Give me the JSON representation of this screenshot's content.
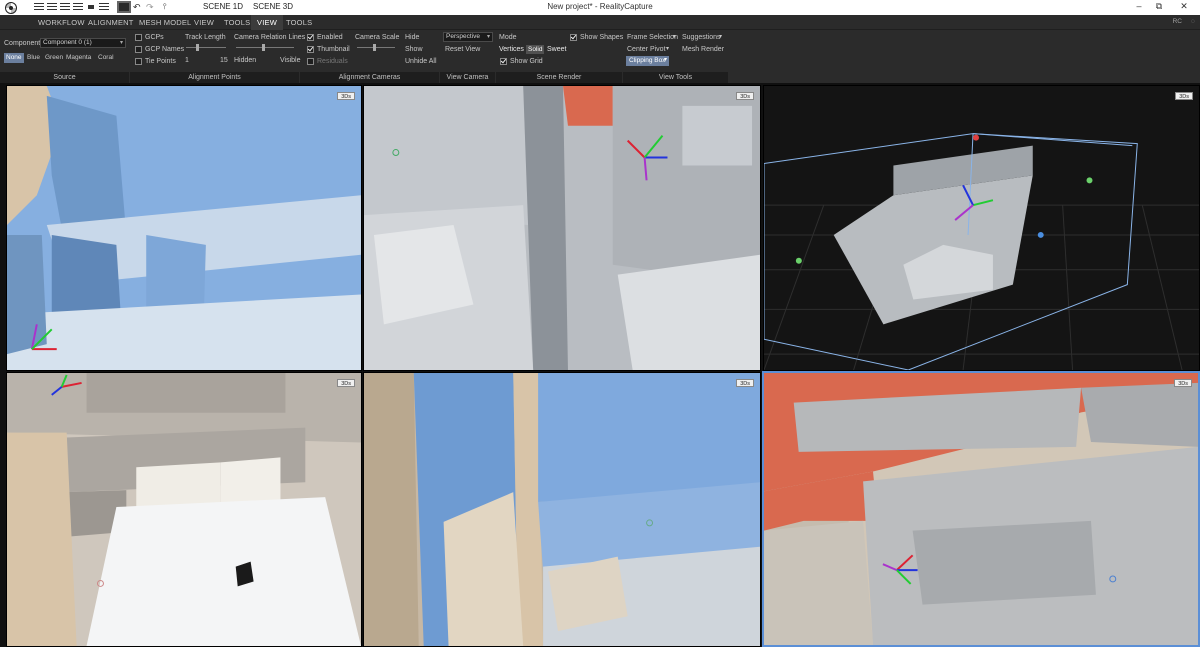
{
  "titlebar": {
    "scene_tabs": [
      "SCENE 1D",
      "SCENE 3D"
    ],
    "window_title": "New project* - RealityCapture",
    "controls": {
      "minimize": "–",
      "maximize": "⧉",
      "close": "✕"
    }
  },
  "menu": {
    "items": [
      "WORKFLOW",
      "ALIGNMENT",
      "MESH MODEL",
      "VIEW",
      "TOOLS",
      "VIEW",
      "TOOLS"
    ],
    "active_index": 5,
    "account_initials": "RC"
  },
  "ribbon": {
    "source": {
      "component_label": "Component",
      "component_value": "Component 0 (1)",
      "colors": [
        "None",
        "Blue",
        "Green",
        "Magenta",
        "Coral"
      ],
      "selected_color_index": 0,
      "section": "Source"
    },
    "alignment_points": {
      "gcps": "GCPs",
      "gcp_names": "GCP Names",
      "tie_points": "Tie Points",
      "track_length": "Track Length",
      "track_min": "1",
      "track_max": "15",
      "camera_relation_lines": "Camera Relation Lines",
      "hidden": "Hidden",
      "visible": "Visible",
      "section": "Alignment Points"
    },
    "alignment_cameras": {
      "enabled": "Enabled",
      "thumbnail": "Thumbnail",
      "residuals": "Residuals",
      "camera_scale": "Camera Scale",
      "hide": "Hide",
      "show": "Show",
      "unhide_all": "Unhide All",
      "section": "Alignment Cameras"
    },
    "view_camera": {
      "projection": "Perspective",
      "reset_view": "Reset View",
      "section": "View Camera"
    },
    "scene_render": {
      "mode": "Mode",
      "modes": [
        "Vertices",
        "Solid",
        "Sweet"
      ],
      "selected_mode_index": 1,
      "show_shapes": "Show Shapes",
      "show_grid": "Show Grid",
      "section": "Scene Render"
    },
    "view_tools": {
      "frame_selection": "Frame Selection",
      "suggestions": "Suggestions",
      "center_pivot": "Center Pivot",
      "mesh_render": "Mesh Render",
      "clipping_box": "Clipping Box",
      "section": "View Tools"
    }
  },
  "viewports": [
    {
      "tag": "3Ds"
    },
    {
      "tag": "3Ds"
    },
    {
      "tag": "3Ds"
    },
    {
      "tag": "3Ds"
    },
    {
      "tag": "3Ds"
    },
    {
      "tag": "3Ds"
    }
  ],
  "colors": {
    "chrome": "#2b2b2b",
    "section_bar": "#1e1e1e",
    "selection_blue": "#6b7f9e",
    "active_viewport_border": "#5b8fd6",
    "mesh_blue": "#7aa6d6",
    "mesh_beige": "#d8c4a8",
    "mesh_grey": "#b4b4b4",
    "mesh_coral": "#d9694f",
    "mesh_white": "#e8eef3"
  }
}
